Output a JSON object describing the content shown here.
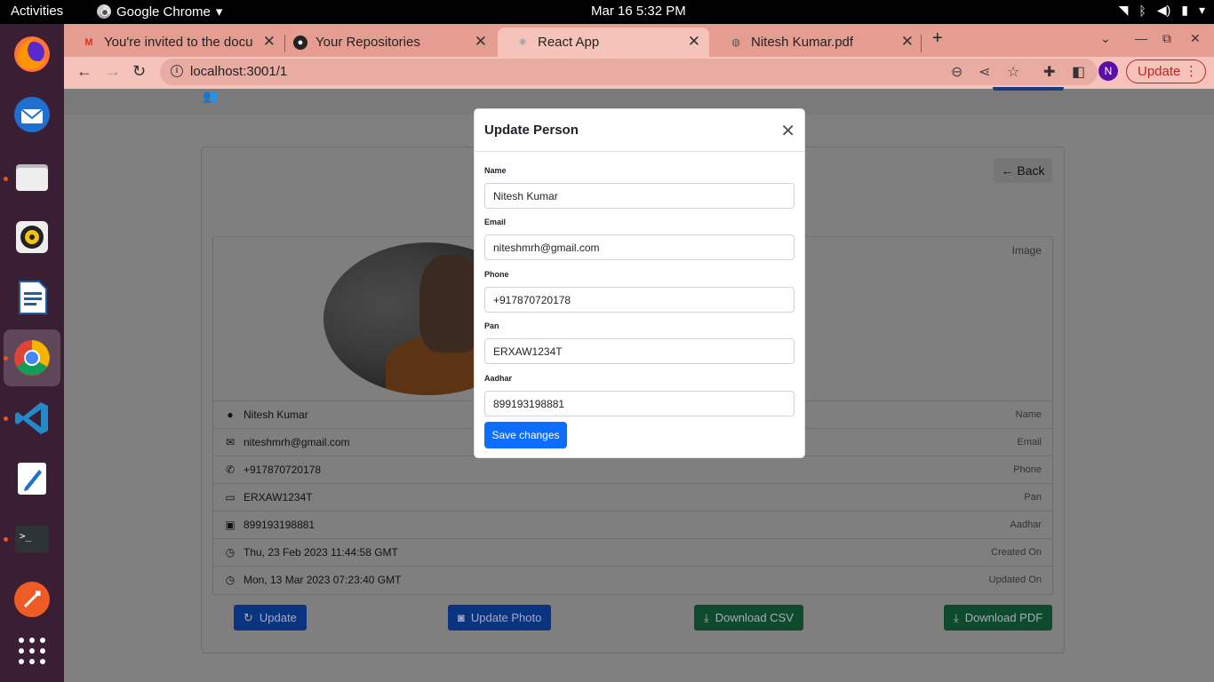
{
  "topbar": {
    "activities": "Activities",
    "app_name": "Google Chrome",
    "clock": "Mar 16  5:32 PM"
  },
  "browser": {
    "tabs": [
      {
        "title": "You're invited to the docu",
        "icon": "gmail-icon"
      },
      {
        "title": "Your Repositories",
        "icon": "github-icon"
      },
      {
        "title": "React App",
        "icon": "react-icon",
        "active": true
      },
      {
        "title": "Nitesh Kumar.pdf",
        "icon": "globe-icon"
      }
    ],
    "url": "localhost:3001/1",
    "avatar_letter": "N",
    "update_label": "Update"
  },
  "page": {
    "back_label": "Back",
    "image_label": "Image",
    "rows": [
      {
        "value": "Nitesh Kumar",
        "label": "Name",
        "icon": "person-icon"
      },
      {
        "value": "niteshmrh@gmail.com",
        "label": "Email",
        "icon": "mail-icon"
      },
      {
        "value": "+917870720178",
        "label": "Phone",
        "icon": "phone-icon"
      },
      {
        "value": "ERXAW1234T",
        "label": "Pan",
        "icon": "card-icon"
      },
      {
        "value": "899193198881",
        "label": "Aadhar",
        "icon": "id-card-icon"
      },
      {
        "value": "Thu, 23 Feb 2023 11:44:58 GMT",
        "label": "Created On",
        "icon": "clock-icon"
      },
      {
        "value": "Mon, 13 Mar 2023 07:23:40 GMT",
        "label": "Updated On",
        "icon": "clock-icon"
      }
    ],
    "actions": {
      "update": "Update",
      "update_photo": "Update Photo",
      "download_csv": "Download CSV",
      "download_pdf": "Download PDF"
    }
  },
  "modal": {
    "title": "Update Person",
    "fields": [
      {
        "label": "Name",
        "value": "Nitesh Kumar"
      },
      {
        "label": "Email",
        "value": "niteshmrh@gmail.com"
      },
      {
        "label": "Phone",
        "value": "+917870720178"
      },
      {
        "label": "Pan",
        "value": "ERXAW1234T"
      },
      {
        "label": "Aadhar",
        "value": "899193198881"
      }
    ],
    "save_label": "Save changes"
  },
  "colors": {
    "primary": "#0d6efd",
    "tab_strip": "#e59d92",
    "toolbar": "#f6c3bb",
    "dock": "#3a1f34"
  }
}
